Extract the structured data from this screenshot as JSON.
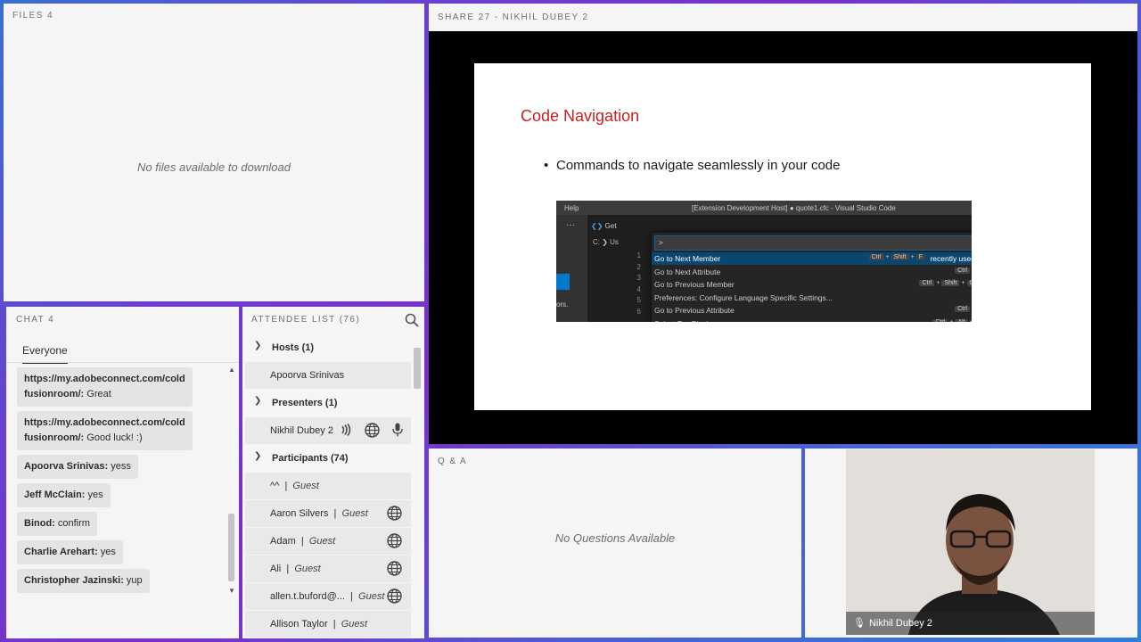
{
  "files": {
    "title": "FILES 4",
    "empty": "No files available to download"
  },
  "share": {
    "title": "SHARE 27  - NIKHIL DUBEY 2",
    "slide": {
      "title": "Code Navigation",
      "bullet": "Commands to navigate seamlessly in your code",
      "vscode": {
        "menu": "Help",
        "window_title": "[Extension Development Host] ● quote1.cfc - Visual Studio Code",
        "tab": "Get",
        "line_info": "C: ❯ Us",
        "side_text": "ors.",
        "input": ">",
        "line_numbers": [
          "1",
          "2",
          "3",
          "4",
          "5",
          "6"
        ],
        "commands": [
          {
            "label": "Go to Next Member",
            "keys": [
              "Ctrl",
              "+",
              "Shift",
              "+",
              "F"
            ],
            "extra": "recently used"
          },
          {
            "label": "Go to Next Attribute",
            "keys": [
              "Ctrl",
              "+",
              "]"
            ],
            "extra": ""
          },
          {
            "label": "Go to Previous Member",
            "keys": [
              "Ctrl",
              "+",
              "Shift",
              "+",
              "Q"
            ],
            "extra": ""
          },
          {
            "label": "Preferences: Configure Language Specific Settings...",
            "keys": [],
            "extra": ""
          },
          {
            "label": "Go to Previous Attribute",
            "keys": [
              "Ctrl",
              "+",
              "["
            ],
            "extra": ""
          },
          {
            "label": "Select Tag Block",
            "keys": [
              "Ctrl",
              "+",
              "Alt",
              "+",
              "F"
            ],
            "extra": ""
          }
        ]
      }
    }
  },
  "chat": {
    "title": "CHAT 4",
    "tab": "Everyone",
    "messages": [
      {
        "sender": "https://my.adobeconnect.com/cold",
        "sender2": "fusionroom/:",
        "text": "Great"
      },
      {
        "sender": "https://my.adobeconnect.com/cold",
        "sender2": "fusionroom/:",
        "text": "Good luck! :)"
      },
      {
        "sender": "Apoorva Srinivas:",
        "text": "yess"
      },
      {
        "sender": "Jeff McClain:",
        "text": "yes"
      },
      {
        "sender": "Binod:",
        "text": "confirm"
      },
      {
        "sender": "Charlie Arehart:",
        "text": "yes"
      },
      {
        "sender": "Christopher Jazinski:",
        "text": "yup"
      }
    ]
  },
  "attendees": {
    "title": "ATTENDEE LIST  (76)",
    "groups": {
      "hosts": "Hosts (1)",
      "presenters": "Presenters (1)",
      "participants": "Participants (74)"
    },
    "host": "Apoorva Srinivas",
    "presenter": "Nikhil Dubey 2",
    "participants": [
      {
        "name": "^^",
        "role": "Guest"
      },
      {
        "name": "Aaron Silvers",
        "role": "Guest"
      },
      {
        "name": "Adam",
        "role": "Guest"
      },
      {
        "name": "Ali",
        "role": "Guest"
      },
      {
        "name": "allen.t.buford@...",
        "role": "Guest"
      },
      {
        "name": "Allison Taylor",
        "role": "Guest"
      }
    ]
  },
  "qa": {
    "title": "Q & A",
    "empty": "No Questions Available"
  },
  "video": {
    "name": "Nikhil Dubey 2"
  }
}
